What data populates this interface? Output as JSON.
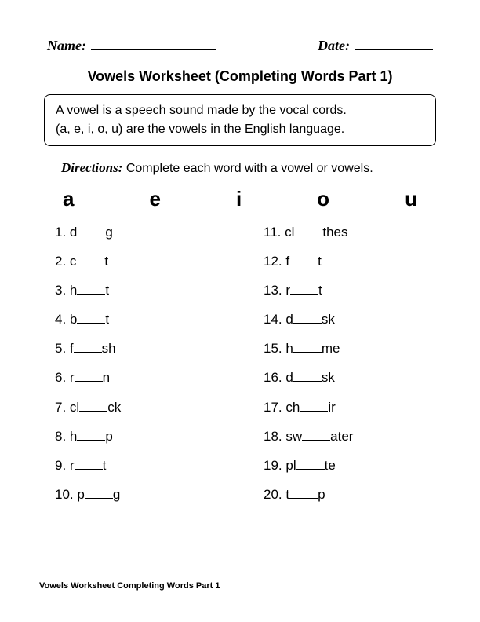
{
  "header": {
    "name_label": "Name:",
    "date_label": "Date:"
  },
  "title": "Vowels Worksheet (Completing Words Part 1)",
  "info_box": {
    "line1": "A vowel is a speech sound made by the vocal cords.",
    "line2": "(a, e, i, o, u) are the vowels in the English language."
  },
  "directions": {
    "label": "Directions:",
    "text": "Complete each word with a vowel or vowels."
  },
  "vowels": [
    "a",
    "e",
    "i",
    "o",
    "u"
  ],
  "items_left": [
    {
      "num": "1.",
      "pre": "d",
      "post": "g"
    },
    {
      "num": "2.",
      "pre": "c",
      "post": "t"
    },
    {
      "num": "3.",
      "pre": "h",
      "post": "t"
    },
    {
      "num": "4.",
      "pre": "b",
      "post": "t"
    },
    {
      "num": "5.",
      "pre": "f",
      "post": "sh"
    },
    {
      "num": "6.",
      "pre": "r",
      "post": "n"
    },
    {
      "num": "7.",
      "pre": "cl",
      "post": "ck"
    },
    {
      "num": "8.",
      "pre": "h",
      "post": "p"
    },
    {
      "num": "9.",
      "pre": "r",
      "post": "t"
    },
    {
      "num": "10.",
      "pre": "p",
      "post": "g"
    }
  ],
  "items_right": [
    {
      "num": "11.",
      "pre": "cl",
      "post": "thes"
    },
    {
      "num": "12.",
      "pre": "f",
      "post": "t"
    },
    {
      "num": "13.",
      "pre": "r",
      "post": "t"
    },
    {
      "num": "14.",
      "pre": "d",
      "post": "sk"
    },
    {
      "num": "15.",
      "pre": "h",
      "post": "me"
    },
    {
      "num": "16.",
      "pre": "d",
      "post": "sk"
    },
    {
      "num": "17.",
      "pre": "ch",
      "post": "ir"
    },
    {
      "num": "18.",
      "pre": "sw",
      "post": "ater"
    },
    {
      "num": "19.",
      "pre": "pl",
      "post": "te"
    },
    {
      "num": "20.",
      "pre": "t",
      "post": "p"
    }
  ],
  "footer": "Vowels Worksheet Completing Words Part 1"
}
